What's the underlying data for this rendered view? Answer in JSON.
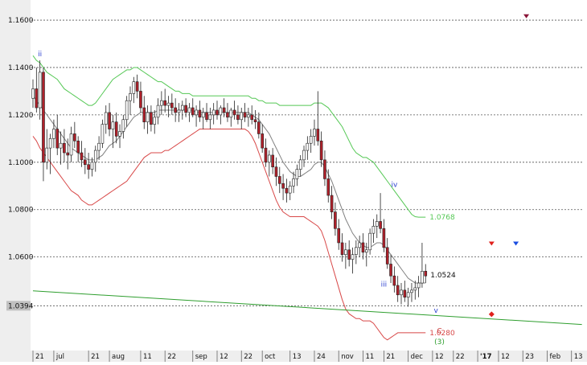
{
  "chart_data": {
    "type": "candlestick",
    "title": "",
    "xlabel": "",
    "ylabel": "",
    "ylim": [
      1.0205,
      1.1685
    ],
    "grid": true,
    "y_ticks": [
      "1.1600",
      "1.1400",
      "1.1200",
      "1.1000",
      "1.0800",
      "1.0600"
    ],
    "y_tick_values": [
      1.16,
      1.14,
      1.12,
      1.1,
      1.08,
      1.06
    ],
    "current_price_label": "1.0394",
    "current_price": 1.0394,
    "x_ticks": [
      {
        "label": "21",
        "i": 0
      },
      {
        "label": "jul",
        "i": 6
      },
      {
        "label": "21",
        "i": 16
      },
      {
        "label": "aug",
        "i": 22
      },
      {
        "label": "11",
        "i": 31
      },
      {
        "label": "22",
        "i": 38
      },
      {
        "label": "sep",
        "i": 46
      },
      {
        "label": "12",
        "i": 53
      },
      {
        "label": "22",
        "i": 60
      },
      {
        "label": "oct",
        "i": 66
      },
      {
        "label": "13",
        "i": 74
      },
      {
        "label": "24",
        "i": 81
      },
      {
        "label": "nov",
        "i": 88
      },
      {
        "label": "11",
        "i": 95
      },
      {
        "label": "21",
        "i": 101
      },
      {
        "label": "dec",
        "i": 108
      },
      {
        "label": "12",
        "i": 115
      },
      {
        "label": "22",
        "i": 121
      },
      {
        "label": "'17",
        "i": 128
      },
      {
        "label": "12",
        "i": 134
      },
      {
        "label": "23",
        "i": 141
      },
      {
        "label": "feb",
        "i": 148
      },
      {
        "label": "13",
        "i": 155
      }
    ],
    "x_count": 159,
    "bars": [
      [
        1.127,
        1.135,
        1.123,
        1.131
      ],
      [
        1.131,
        1.14,
        1.121,
        1.123
      ],
      [
        1.123,
        1.143,
        1.118,
        1.138
      ],
      [
        1.138,
        1.14,
        1.092,
        1.1
      ],
      [
        1.1,
        1.114,
        1.097,
        1.106
      ],
      [
        1.106,
        1.112,
        1.095,
        1.11
      ],
      [
        1.11,
        1.118,
        1.106,
        1.114
      ],
      [
        1.114,
        1.12,
        1.103,
        1.106
      ],
      [
        1.106,
        1.113,
        1.099,
        1.108
      ],
      [
        1.108,
        1.114,
        1.1,
        1.104
      ],
      [
        1.104,
        1.11,
        1.097,
        1.103
      ],
      [
        1.103,
        1.115,
        1.1,
        1.112
      ],
      [
        1.112,
        1.117,
        1.106,
        1.109
      ],
      [
        1.109,
        1.111,
        1.1,
        1.104
      ],
      [
        1.104,
        1.109,
        1.098,
        1.101
      ],
      [
        1.101,
        1.106,
        1.095,
        1.099
      ],
      [
        1.099,
        1.104,
        1.093,
        1.097
      ],
      [
        1.097,
        1.102,
        1.094,
        1.1
      ],
      [
        1.1,
        1.107,
        1.096,
        1.105
      ],
      [
        1.105,
        1.111,
        1.101,
        1.108
      ],
      [
        1.108,
        1.118,
        1.106,
        1.116
      ],
      [
        1.116,
        1.124,
        1.112,
        1.121
      ],
      [
        1.121,
        1.125,
        1.111,
        1.114
      ],
      [
        1.114,
        1.12,
        1.106,
        1.117
      ],
      [
        1.117,
        1.121,
        1.108,
        1.111
      ],
      [
        1.111,
        1.116,
        1.106,
        1.113
      ],
      [
        1.113,
        1.12,
        1.11,
        1.118
      ],
      [
        1.118,
        1.128,
        1.115,
        1.126
      ],
      [
        1.126,
        1.132,
        1.12,
        1.129
      ],
      [
        1.129,
        1.136,
        1.125,
        1.134
      ],
      [
        1.134,
        1.137,
        1.127,
        1.13
      ],
      [
        1.13,
        1.134,
        1.121,
        1.123
      ],
      [
        1.123,
        1.128,
        1.114,
        1.117
      ],
      [
        1.117,
        1.124,
        1.112,
        1.121
      ],
      [
        1.121,
        1.124,
        1.113,
        1.116
      ],
      [
        1.116,
        1.122,
        1.112,
        1.119
      ],
      [
        1.119,
        1.127,
        1.116,
        1.124
      ],
      [
        1.124,
        1.13,
        1.12,
        1.126
      ],
      [
        1.126,
        1.131,
        1.121,
        1.124
      ],
      [
        1.124,
        1.128,
        1.119,
        1.125
      ],
      [
        1.125,
        1.129,
        1.12,
        1.123
      ],
      [
        1.123,
        1.127,
        1.117,
        1.121
      ],
      [
        1.121,
        1.125,
        1.117,
        1.122
      ],
      [
        1.122,
        1.126,
        1.118,
        1.124
      ],
      [
        1.124,
        1.127,
        1.119,
        1.121
      ],
      [
        1.121,
        1.125,
        1.117,
        1.123
      ],
      [
        1.123,
        1.127,
        1.119,
        1.12
      ],
      [
        1.12,
        1.124,
        1.115,
        1.122
      ],
      [
        1.122,
        1.126,
        1.117,
        1.119
      ],
      [
        1.119,
        1.123,
        1.114,
        1.121
      ],
      [
        1.121,
        1.125,
        1.117,
        1.118
      ],
      [
        1.118,
        1.123,
        1.114,
        1.12
      ],
      [
        1.12,
        1.125,
        1.116,
        1.122
      ],
      [
        1.122,
        1.126,
        1.118,
        1.12
      ],
      [
        1.12,
        1.124,
        1.116,
        1.123
      ],
      [
        1.123,
        1.127,
        1.119,
        1.121
      ],
      [
        1.121,
        1.125,
        1.117,
        1.119
      ],
      [
        1.119,
        1.123,
        1.115,
        1.122
      ],
      [
        1.122,
        1.126,
        1.118,
        1.12
      ],
      [
        1.12,
        1.124,
        1.116,
        1.118
      ],
      [
        1.118,
        1.123,
        1.114,
        1.121
      ],
      [
        1.121,
        1.125,
        1.117,
        1.119
      ],
      [
        1.119,
        1.123,
        1.115,
        1.12
      ],
      [
        1.12,
        1.124,
        1.116,
        1.118
      ],
      [
        1.118,
        1.122,
        1.114,
        1.117
      ],
      [
        1.117,
        1.121,
        1.11,
        1.112
      ],
      [
        1.112,
        1.116,
        1.104,
        1.106
      ],
      [
        1.106,
        1.11,
        1.098,
        1.1
      ],
      [
        1.1,
        1.105,
        1.094,
        1.103
      ],
      [
        1.103,
        1.106,
        1.095,
        1.098
      ],
      [
        1.098,
        1.102,
        1.09,
        1.094
      ],
      [
        1.094,
        1.098,
        1.087,
        1.091
      ],
      [
        1.091,
        1.095,
        1.084,
        1.089
      ],
      [
        1.089,
        1.093,
        1.083,
        1.087
      ],
      [
        1.087,
        1.092,
        1.084,
        1.09
      ],
      [
        1.09,
        1.096,
        1.087,
        1.093
      ],
      [
        1.093,
        1.099,
        1.09,
        1.097
      ],
      [
        1.097,
        1.103,
        1.094,
        1.101
      ],
      [
        1.101,
        1.107,
        1.098,
        1.105
      ],
      [
        1.105,
        1.111,
        1.101,
        1.108
      ],
      [
        1.108,
        1.114,
        1.104,
        1.111
      ],
      [
        1.111,
        1.118,
        1.107,
        1.114
      ],
      [
        1.114,
        1.13,
        1.107,
        1.109
      ],
      [
        1.109,
        1.113,
        1.098,
        1.101
      ],
      [
        1.101,
        1.105,
        1.09,
        1.093
      ],
      [
        1.093,
        1.097,
        1.083,
        1.086
      ],
      [
        1.086,
        1.09,
        1.076,
        1.079
      ],
      [
        1.079,
        1.083,
        1.069,
        1.072
      ],
      [
        1.072,
        1.076,
        1.063,
        1.066
      ],
      [
        1.066,
        1.07,
        1.058,
        1.061
      ],
      [
        1.061,
        1.066,
        1.055,
        1.063
      ],
      [
        1.063,
        1.067,
        1.056,
        1.059
      ],
      [
        1.059,
        1.064,
        1.053,
        1.061
      ],
      [
        1.061,
        1.067,
        1.057,
        1.064
      ],
      [
        1.064,
        1.069,
        1.06,
        1.066
      ],
      [
        1.066,
        1.07,
        1.059,
        1.062
      ],
      [
        1.062,
        1.066,
        1.056,
        1.063
      ],
      [
        1.063,
        1.072,
        1.061,
        1.07
      ],
      [
        1.07,
        1.076,
        1.066,
        1.073
      ],
      [
        1.073,
        1.078,
        1.068,
        1.075
      ],
      [
        1.075,
        1.087,
        1.07,
        1.072
      ],
      [
        1.072,
        1.076,
        1.062,
        1.064
      ],
      [
        1.064,
        1.068,
        1.055,
        1.057
      ],
      [
        1.057,
        1.061,
        1.049,
        1.052
      ],
      [
        1.052,
        1.056,
        1.045,
        1.048
      ],
      [
        1.048,
        1.052,
        1.041,
        1.044
      ],
      [
        1.044,
        1.049,
        1.04,
        1.046
      ],
      [
        1.046,
        1.05,
        1.041,
        1.043
      ],
      [
        1.043,
        1.047,
        1.039,
        1.045
      ],
      [
        1.045,
        1.049,
        1.041,
        1.046
      ],
      [
        1.046,
        1.05,
        1.042,
        1.047
      ],
      [
        1.047,
        1.052,
        1.043,
        1.049
      ],
      [
        1.049,
        1.066,
        1.047,
        1.054
      ],
      [
        1.054,
        1.057,
        1.049,
        1.052
      ]
    ],
    "series": [
      {
        "type": "line",
        "color": "#808080",
        "values": [
          1.128,
          1.126,
          1.124,
          1.122,
          1.12,
          1.118,
          1.116,
          1.114,
          1.112,
          1.11,
          1.108,
          1.106,
          1.105,
          1.104,
          1.103,
          1.102,
          1.101,
          1.101,
          1.101,
          1.102,
          1.103,
          1.105,
          1.107,
          1.108,
          1.109,
          1.111,
          1.113,
          1.115,
          1.117,
          1.119,
          1.12,
          1.121,
          1.121,
          1.121,
          1.121,
          1.121,
          1.122,
          1.122,
          1.122,
          1.122,
          1.122,
          1.122,
          1.122,
          1.122,
          1.122,
          1.122,
          1.122,
          1.121,
          1.121,
          1.121,
          1.121,
          1.121,
          1.121,
          1.121,
          1.121,
          1.121,
          1.121,
          1.121,
          1.121,
          1.121,
          1.121,
          1.121,
          1.121,
          1.12,
          1.119,
          1.118,
          1.116,
          1.114,
          1.112,
          1.109,
          1.106,
          1.103,
          1.1,
          1.098,
          1.096,
          1.095,
          1.094,
          1.094,
          1.095,
          1.096,
          1.097,
          1.099,
          1.1,
          1.1,
          1.098,
          1.095,
          1.092,
          1.088,
          1.084,
          1.08,
          1.076,
          1.073,
          1.07,
          1.068,
          1.066,
          1.065,
          1.064,
          1.064,
          1.065,
          1.066,
          1.066,
          1.065,
          1.063,
          1.061,
          1.059,
          1.057,
          1.055,
          1.053,
          1.051,
          1.05,
          1.049,
          1.049,
          1.049,
          1.049
        ]
      },
      {
        "type": "line",
        "color": "#55c855",
        "label": "1.0768",
        "label_value": 1.0768,
        "values": [
          1.145,
          1.143,
          1.142,
          1.14,
          1.138,
          1.137,
          1.136,
          1.135,
          1.133,
          1.131,
          1.13,
          1.129,
          1.128,
          1.127,
          1.126,
          1.125,
          1.124,
          1.124,
          1.125,
          1.127,
          1.129,
          1.131,
          1.133,
          1.135,
          1.136,
          1.137,
          1.138,
          1.139,
          1.139,
          1.14,
          1.14,
          1.139,
          1.138,
          1.137,
          1.136,
          1.135,
          1.134,
          1.134,
          1.133,
          1.132,
          1.131,
          1.13,
          1.13,
          1.129,
          1.129,
          1.129,
          1.128,
          1.128,
          1.128,
          1.128,
          1.128,
          1.128,
          1.128,
          1.128,
          1.128,
          1.128,
          1.128,
          1.128,
          1.128,
          1.128,
          1.128,
          1.128,
          1.128,
          1.127,
          1.127,
          1.126,
          1.126,
          1.125,
          1.125,
          1.125,
          1.125,
          1.124,
          1.124,
          1.124,
          1.124,
          1.124,
          1.124,
          1.124,
          1.124,
          1.124,
          1.124,
          1.125,
          1.125,
          1.125,
          1.124,
          1.123,
          1.121,
          1.119,
          1.117,
          1.115,
          1.112,
          1.109,
          1.106,
          1.104,
          1.103,
          1.102,
          1.102,
          1.101,
          1.1,
          1.098,
          1.096,
          1.094,
          1.092,
          1.09,
          1.088,
          1.086,
          1.084,
          1.082,
          1.08,
          1.078,
          1.077,
          1.0768,
          1.0768,
          1.0768
        ]
      },
      {
        "type": "line",
        "color": "#d84848",
        "label": "1.0280",
        "label_value": 1.028,
        "values": [
          1.111,
          1.109,
          1.106,
          1.104,
          1.102,
          1.1,
          1.098,
          1.096,
          1.094,
          1.092,
          1.09,
          1.088,
          1.087,
          1.086,
          1.084,
          1.083,
          1.082,
          1.082,
          1.083,
          1.084,
          1.085,
          1.086,
          1.087,
          1.088,
          1.089,
          1.09,
          1.091,
          1.092,
          1.094,
          1.096,
          1.098,
          1.1,
          1.102,
          1.103,
          1.104,
          1.104,
          1.104,
          1.104,
          1.105,
          1.105,
          1.106,
          1.107,
          1.108,
          1.109,
          1.11,
          1.111,
          1.112,
          1.113,
          1.114,
          1.114,
          1.114,
          1.114,
          1.114,
          1.114,
          1.114,
          1.114,
          1.114,
          1.114,
          1.114,
          1.114,
          1.114,
          1.114,
          1.113,
          1.111,
          1.108,
          1.104,
          1.1,
          1.096,
          1.092,
          1.088,
          1.084,
          1.081,
          1.079,
          1.078,
          1.077,
          1.077,
          1.077,
          1.077,
          1.077,
          1.076,
          1.075,
          1.074,
          1.073,
          1.071,
          1.067,
          1.062,
          1.057,
          1.052,
          1.047,
          1.042,
          1.038,
          1.036,
          1.035,
          1.034,
          1.034,
          1.033,
          1.033,
          1.033,
          1.032,
          1.03,
          1.028,
          1.026,
          1.025,
          1.026,
          1.027,
          1.028,
          1.028,
          1.028,
          1.028,
          1.028,
          1.028,
          1.028,
          1.028,
          1.028
        ]
      },
      {
        "type": "line",
        "color": "#2e9e2e",
        "name": "trendline",
        "points": [
          [
            0,
            1.0457
          ],
          [
            158,
            1.0315
          ]
        ]
      }
    ],
    "annotations": [
      {
        "text": "ii",
        "i": 2,
        "y": 1.1447,
        "color": "#2a3fd0"
      },
      {
        "text": "iv",
        "i": 104,
        "y": 1.0895,
        "color": "#2a3fd0"
      },
      {
        "text": "iii",
        "i": 101,
        "y": 1.0475,
        "color": "#2a3fd0"
      },
      {
        "text": "v",
        "i": 116,
        "y": 1.0365,
        "color": "#2a3fd0"
      },
      {
        "text": "C",
        "i": 117,
        "y": 1.0278,
        "color": "#c83c3c"
      },
      {
        "text": "(3)",
        "i": 117,
        "y": 1.0232,
        "color": "#2e9e2e"
      }
    ],
    "markers": [
      {
        "shape": "triangle-down",
        "color": "#8a1538",
        "i": 142,
        "y": 1.1618
      },
      {
        "shape": "triangle-down",
        "color": "#e0201c",
        "i": 132,
        "y": 1.0658
      },
      {
        "shape": "triangle-down",
        "color": "#1a4de0",
        "i": 139,
        "y": 1.0658
      },
      {
        "shape": "diamond",
        "color": "#e0201c",
        "i": 132,
        "y": 1.0358
      }
    ],
    "last_close_label": "1.0524",
    "last_close": 1.0524
  }
}
